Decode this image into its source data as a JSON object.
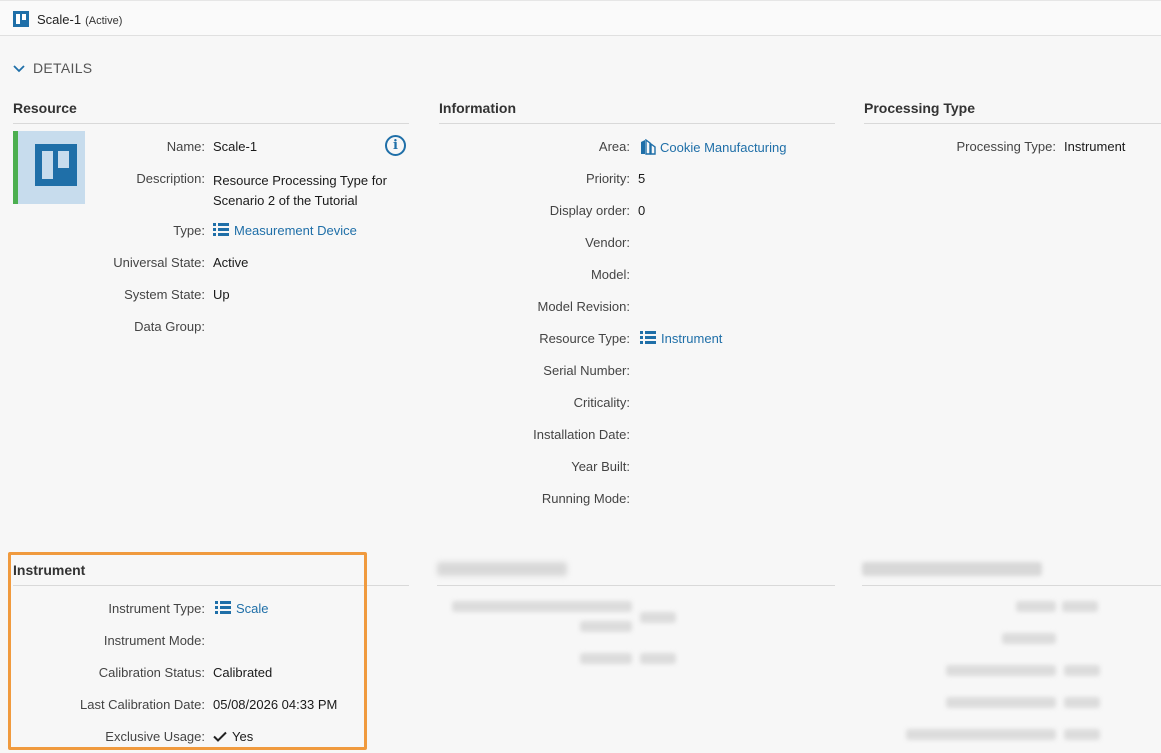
{
  "header": {
    "title": "Scale-1",
    "state": "(Active)"
  },
  "details": {
    "label": "DETAILS"
  },
  "resource": {
    "section_title": "Resource",
    "name_label": "Name:",
    "name_value": "Scale-1",
    "description_label": "Description:",
    "description_line1": "Resource Processing Type for",
    "description_line2": "Scenario 2 of the Tutorial",
    "type_label": "Type:",
    "type_value": "Measurement Device",
    "universal_state_label": "Universal State:",
    "universal_state_value": "Active",
    "system_state_label": "System State:",
    "system_state_value": "Up",
    "data_group_label": "Data Group:"
  },
  "information": {
    "section_title": "Information",
    "area_label": "Area:",
    "area_value": "Cookie Manufacturing",
    "priority_label": "Priority:",
    "priority_value": "5",
    "display_order_label": "Display order:",
    "display_order_value": "0",
    "vendor_label": "Vendor:",
    "model_label": "Model:",
    "model_revision_label": "Model Revision:",
    "resource_type_label": "Resource Type:",
    "resource_type_value": "Instrument",
    "serial_number_label": "Serial Number:",
    "criticality_label": "Criticality:",
    "installation_date_label": "Installation Date:",
    "year_built_label": "Year Built:",
    "running_mode_label": "Running Mode:"
  },
  "processing_type": {
    "section_title": "Processing Type",
    "label": "Processing Type:",
    "value": "Instrument"
  },
  "instrument": {
    "section_title": "Instrument",
    "instrument_type_label": "Instrument Type:",
    "instrument_type_value": "Scale",
    "instrument_mode_label": "Instrument Mode:",
    "calibration_status_label": "Calibration Status:",
    "calibration_status_value": "Calibrated",
    "last_calibration_date_label": "Last Calibration Date:",
    "last_calibration_date_value": "05/08/2026 04:33 PM",
    "exclusive_usage_label": "Exclusive Usage:",
    "exclusive_usage_value": "Yes"
  },
  "colors": {
    "accent": "#1f6fa8",
    "state_bar": "#4caf50",
    "highlight": "#f09a3e"
  }
}
